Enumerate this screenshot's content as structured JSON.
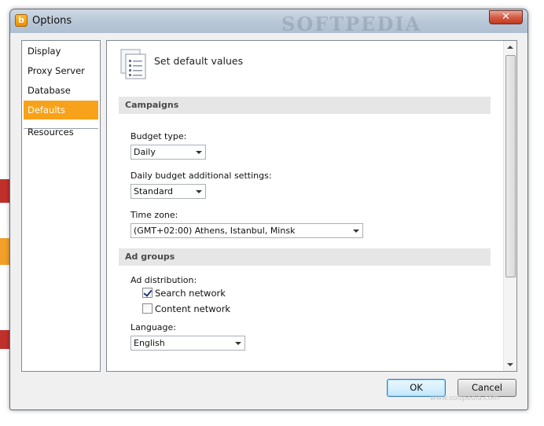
{
  "window": {
    "title": "Options",
    "app_icon_letter": "b",
    "close_glyph": "✕",
    "watermark": "SOFTPEDIA"
  },
  "nav": {
    "items": [
      {
        "label": "Display"
      },
      {
        "label": "Proxy Server"
      },
      {
        "label": "Database"
      },
      {
        "label": "Defaults",
        "selected": true
      },
      {
        "label": "Resources"
      }
    ]
  },
  "panel": {
    "heading": "Set default values",
    "heading_icon": "document-list-icon",
    "campaigns": {
      "title": "Campaigns",
      "budget_type_label": "Budget type:",
      "budget_type_value": "Daily",
      "daily_budget_label": "Daily budget additional settings:",
      "daily_budget_value": "Standard",
      "time_zone_label": "Time zone:",
      "time_zone_value": "(GMT+02:00) Athens, Istanbul, Minsk"
    },
    "ad_groups": {
      "title": "Ad groups",
      "ad_distribution_label": "Ad distribution:",
      "search_network_label": "Search network",
      "search_network_checked": true,
      "content_network_label": "Content network",
      "content_network_checked": false,
      "language_label": "Language:",
      "language_value": "English"
    }
  },
  "buttons": {
    "ok": "OK",
    "cancel": "Cancel"
  },
  "footer_watermark": "www.softpedia.com",
  "colors": {
    "selected_nav": "#f7a21a",
    "section_bar": "#e6e6e6",
    "title_bar": "#b9c8d8"
  }
}
